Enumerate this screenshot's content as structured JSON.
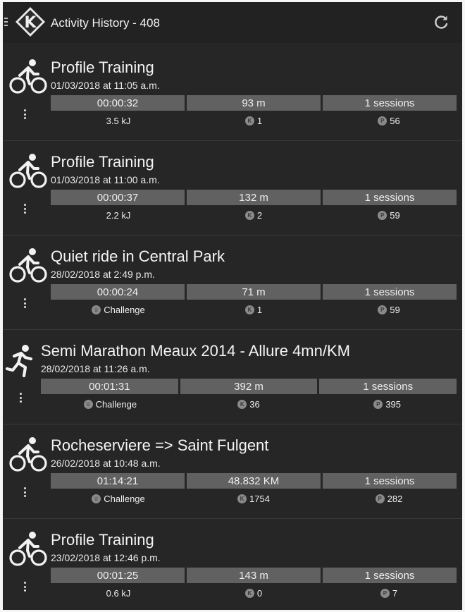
{
  "header": {
    "title": "Activity History - 408",
    "logo_letter": "K",
    "refresh_icon": "refresh-icon",
    "menu_icon": "drawer-handle-icon"
  },
  "activities": [
    {
      "sport": "bike",
      "title": "Profile Training",
      "date": "01/03/2018 at 11:05 a.m.",
      "duration": "00:00:32",
      "distance": "93 m",
      "sessions": "1 sessions",
      "extra": "3.5 kJ",
      "extra_icon": "",
      "k_count": "1",
      "p_count": "56"
    },
    {
      "sport": "bike",
      "title": "Profile Training",
      "date": "01/03/2018 at 11:00 a.m.",
      "duration": "00:00:37",
      "distance": "132 m",
      "sessions": "1 sessions",
      "extra": "2.2 kJ",
      "extra_icon": "",
      "k_count": "2",
      "p_count": "59"
    },
    {
      "sport": "bike",
      "title": "Quiet ride in Central Park",
      "date": "28/02/2018 at 2:49 p.m.",
      "duration": "00:00:24",
      "distance": "71 m",
      "sessions": "1 sessions",
      "extra": "Challenge",
      "extra_icon": "trophy-icon",
      "k_count": "1",
      "p_count": "59"
    },
    {
      "sport": "run",
      "title": "Semi Marathon Meaux 2014 - Allure 4mn/KM",
      "date": "28/02/2018 at 11:26 a.m.",
      "duration": "00:01:31",
      "distance": "392 m",
      "sessions": "1 sessions",
      "extra": "Challenge",
      "extra_icon": "trophy-icon",
      "k_count": "36",
      "p_count": "395"
    },
    {
      "sport": "bike",
      "title": "Rocheserviere => Saint Fulgent",
      "date": "26/02/2018 at 10:48 a.m.",
      "duration": "01:14:21",
      "distance": "48.832 KM",
      "sessions": "1 sessions",
      "extra": "Challenge",
      "extra_icon": "trophy-icon",
      "k_count": "1754",
      "p_count": "282"
    },
    {
      "sport": "bike",
      "title": "Profile Training",
      "date": "23/02/2018 at 12:46 p.m.",
      "duration": "00:01:25",
      "distance": "143 m",
      "sessions": "1 sessions",
      "extra": "0.6 kJ",
      "extra_icon": "",
      "k_count": "0",
      "p_count": "7"
    }
  ],
  "colors": {
    "background": "#262626",
    "stat_box": "#616161",
    "text": "#f4f4f4"
  }
}
